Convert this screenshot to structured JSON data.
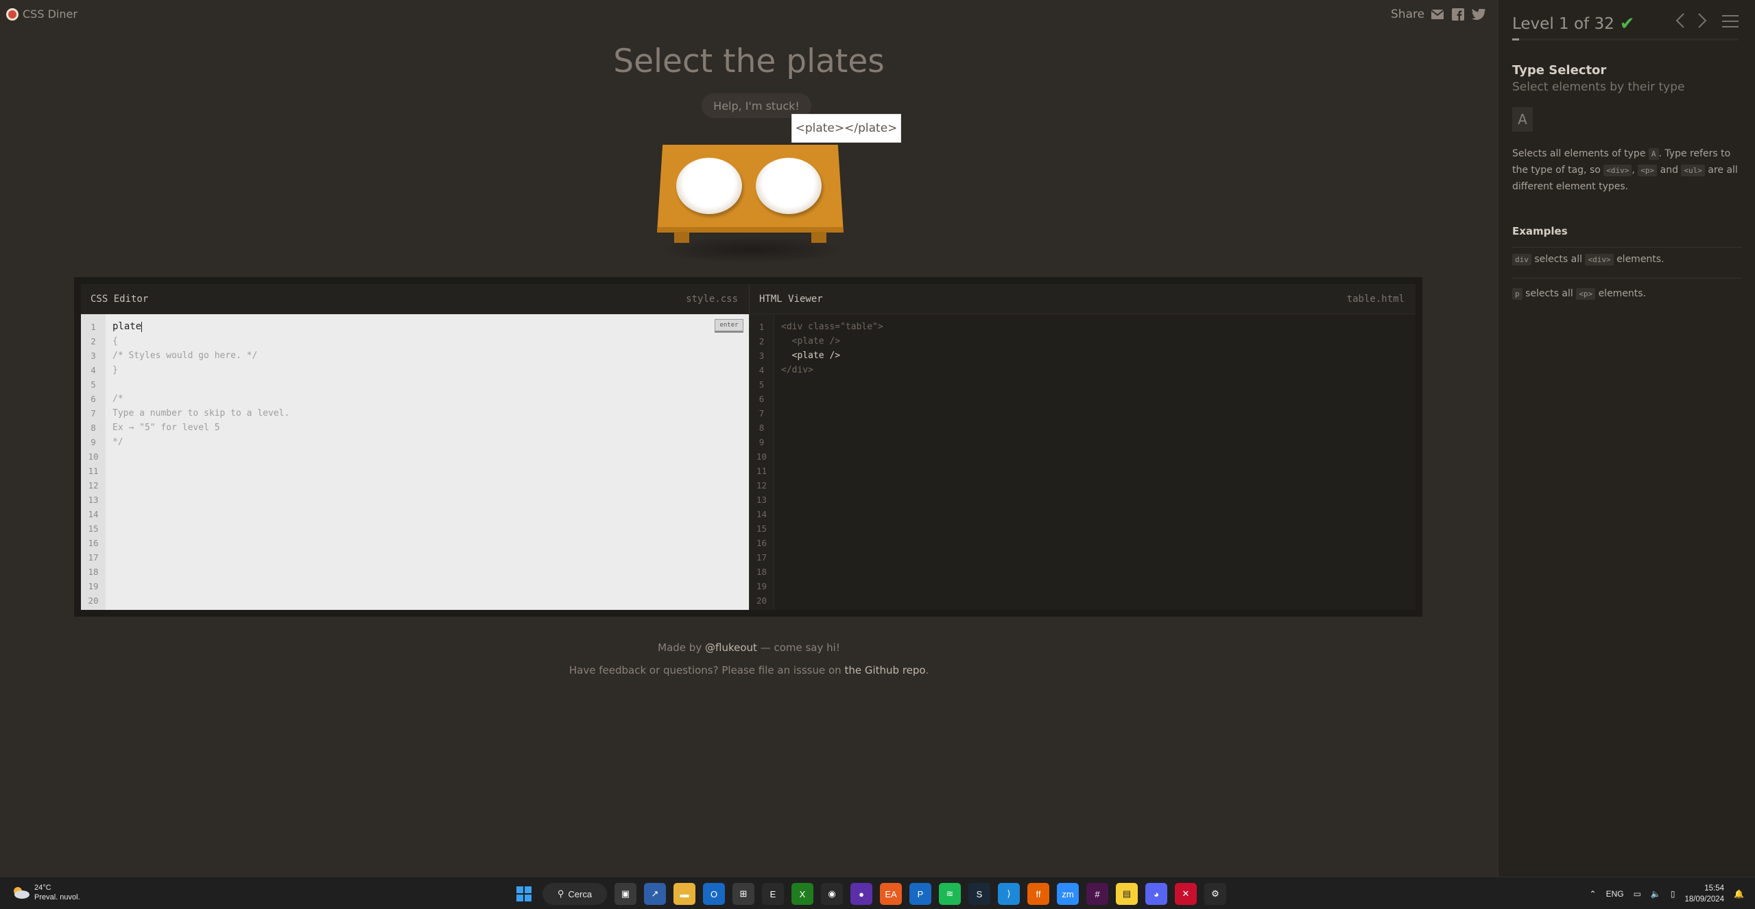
{
  "app": {
    "name": "CSS Diner"
  },
  "share": {
    "label": "Share",
    "icons": [
      "mail-icon",
      "facebook-icon",
      "twitter-icon"
    ]
  },
  "level": {
    "instruction": "Select the plates",
    "help_label": "Help, I'm stuck!",
    "tooltip": "<plate></plate>",
    "plate_count": 2
  },
  "css_editor": {
    "title": "CSS Editor",
    "file": "style.css",
    "input_value": "plate",
    "enter_label": "enter",
    "lines": [
      "",
      "{",
      "/* Styles would go here. */",
      "}",
      "",
      "/*",
      "Type a number to skip to a level.",
      "Ex → \"5\" for level 5",
      "*/",
      "",
      "",
      "",
      "",
      "",
      "",
      "",
      "",
      "",
      "",
      ""
    ],
    "line_numbers": [
      "1",
      "2",
      "3",
      "4",
      "5",
      "6",
      "7",
      "8",
      "9",
      "10",
      "11",
      "12",
      "13",
      "14",
      "15",
      "16",
      "17",
      "18",
      "19",
      "20"
    ]
  },
  "html_viewer": {
    "title": "HTML Viewer",
    "file": "table.html",
    "lines": [
      "<div class=\"table\">",
      "  <plate />",
      "  <plate />",
      "</div>",
      "",
      "",
      "",
      "",
      "",
      "",
      "",
      "",
      "",
      "",
      "",
      "",
      "",
      "",
      "",
      ""
    ],
    "highlighted_line": 3,
    "line_numbers": [
      "1",
      "2",
      "3",
      "4",
      "5",
      "6",
      "7",
      "8",
      "9",
      "10",
      "11",
      "12",
      "13",
      "14",
      "15",
      "16",
      "17",
      "18",
      "19",
      "20"
    ]
  },
  "footer": {
    "line1_prefix": "Made by",
    "line1_link": "@flukeout",
    "line1_suffix": "— come say hi!",
    "line2_prefix": "Have feedback or questions? Please file an isssue on",
    "line2_link": "the Github repo",
    "line2_suffix": "."
  },
  "sidebar": {
    "level_label": "Level 1 of 32",
    "level_current": 1,
    "level_total": 32,
    "completed": true,
    "progress": 0.03,
    "title": "Type Selector",
    "subtitle": "Select elements by their type",
    "syntax": "A",
    "desc": {
      "p1": "Selects all elements of type",
      "tag_a": "A",
      "p2": ". Type refers to the type of tag, so",
      "tag_div": "<div>",
      "comma": ",",
      "tag_p": "<p>",
      "and": "and",
      "tag_ul": "<ul>",
      "p3": "are all different element types."
    },
    "examples_title": "Examples",
    "examples": [
      {
        "code": "div",
        "text1": "selects all",
        "tag": "<div>",
        "text2": "elements."
      },
      {
        "code": "p",
        "text1": "selects all",
        "tag": "<p>",
        "text2": "elements."
      }
    ]
  },
  "taskbar": {
    "weather_temp": "24°C",
    "weather_desc": "Preval. nuvol.",
    "search_label": "Cerca",
    "language": "ENG",
    "time": "15:54",
    "date": "18/09/2024"
  },
  "colors": {
    "accent_check": "#4cb648",
    "table": "#d48d24",
    "logo": "#d04a3c"
  }
}
